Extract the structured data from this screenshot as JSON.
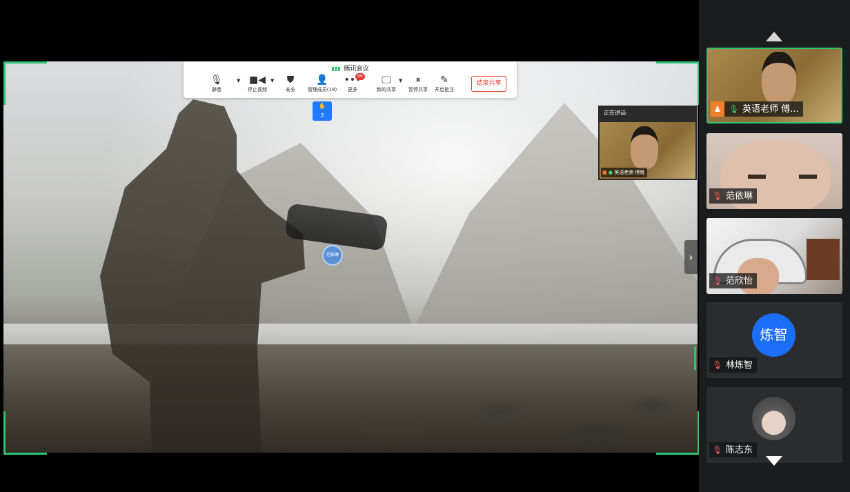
{
  "toolbar": {
    "title": "腾讯会议",
    "buttons": {
      "mute": "静音",
      "stop_video": "停止视频",
      "security": "安全",
      "manage_members": "管理成员(18)",
      "more": "更多",
      "new_share": "新的共享",
      "pause_share": "暂停共享",
      "annotate": "开启批注"
    },
    "more_badge": "99",
    "end_share": "结束共享"
  },
  "hand_raise": {
    "count": "2"
  },
  "cursor_label": "范依琳",
  "speaker": {
    "header": "正在讲话:",
    "name": "英语老师 傅晓"
  },
  "participants": [
    {
      "name": "英语老师 傅...",
      "mic": "on",
      "host": true
    },
    {
      "name": "范依琳",
      "mic": "muted"
    },
    {
      "name": "范欣怡",
      "mic": "muted"
    },
    {
      "name": "林炼智",
      "mic": "muted",
      "avatar_text": "炼智",
      "avatar_color": "#1a6ef7"
    },
    {
      "name": "陈志东",
      "mic": "muted"
    }
  ],
  "colors": {
    "accent_green": "#2bc46f",
    "end_red": "#e53935",
    "avatar_blue": "#1a6ef7",
    "host_orange": "#f0812a"
  }
}
